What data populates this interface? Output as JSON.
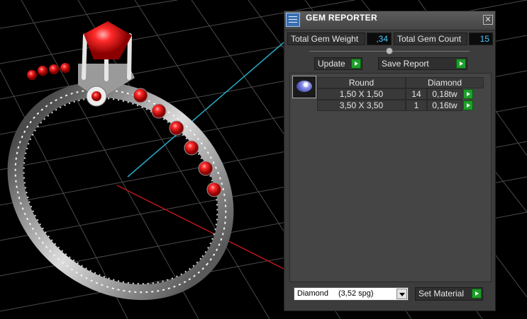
{
  "panel": {
    "title": "GEM REPORTER",
    "close_symbol": "✕",
    "total_weight_label": "Total Gem Weight",
    "total_weight_value": ",34",
    "total_count_label": "Total Gem Count",
    "total_count_value": "15",
    "slider_level": 0.5,
    "update_label": "Update",
    "save_report_label": "Save Report",
    "gem_icon": "round-diamond-icon",
    "table": {
      "headers": [
        "Round",
        "Diamond"
      ],
      "rows": [
        {
          "size": "1,50 X 1,50",
          "count": "14",
          "weight": "0,18tw"
        },
        {
          "size": "3,50 X 3,50",
          "count": "1",
          "weight": "0,16tw"
        }
      ]
    },
    "material": {
      "name": "Diamond",
      "density": "(3,52 spg)"
    },
    "set_material_label": "Set Material"
  },
  "colors": {
    "accent_button": "#1f9e2b",
    "value_text": "#4ec8ff",
    "gem_red": "#e01010"
  }
}
